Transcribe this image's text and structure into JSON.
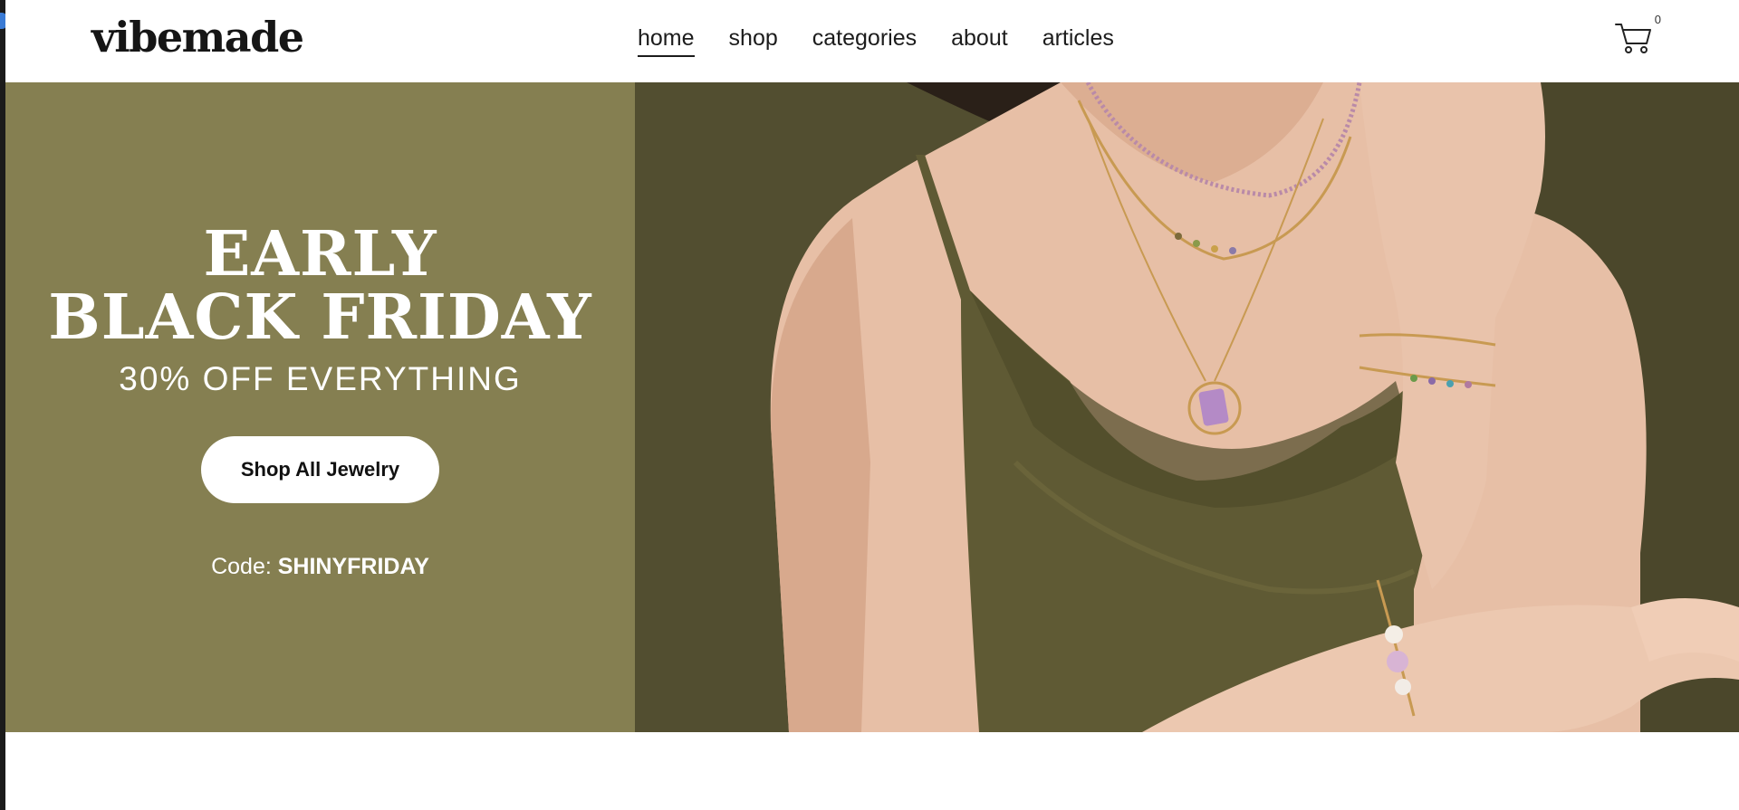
{
  "header": {
    "logo": "vibemade",
    "nav": [
      {
        "label": "home",
        "active": true
      },
      {
        "label": "shop",
        "active": false
      },
      {
        "label": "categories",
        "active": false
      },
      {
        "label": "about",
        "active": false
      },
      {
        "label": "articles",
        "active": false
      }
    ],
    "cart": {
      "icon": "cart-icon",
      "count": "0"
    }
  },
  "hero": {
    "title_line1": "EARLY",
    "title_line2": "BLACK FRIDAY",
    "subtitle": "30% OFF EVERYTHING",
    "button_label": "Shop All Jewelry",
    "code_label": "Code:",
    "code_value": "SHINYFRIDAY",
    "image": "model-wearing-gold-and-gemstone-necklaces-and-bracelets"
  },
  "colors": {
    "promo_bg": "#857f51",
    "photo_bg": "#524e30",
    "text_dark": "#161616"
  }
}
